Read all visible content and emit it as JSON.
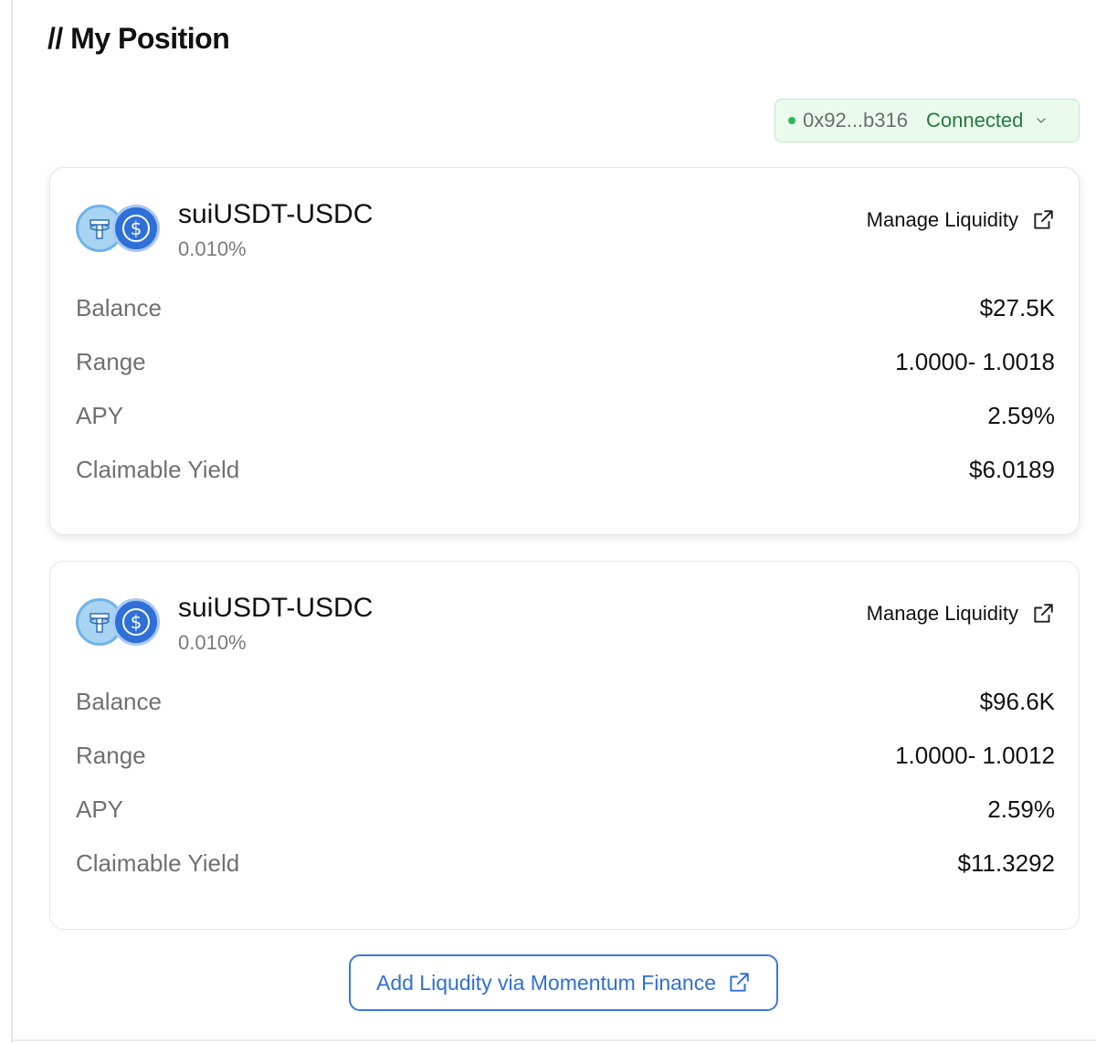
{
  "page": {
    "title": "// My Position"
  },
  "wallet": {
    "address": "0x92...b316",
    "status": "Connected"
  },
  "colors": {
    "accent": "#2f6fd8",
    "connected_green": "#2fb757",
    "connected_bg": "#eafbee"
  },
  "positions": [
    {
      "pair": "suiUSDT-USDC",
      "fee": "0.010%",
      "manage_label": "Manage Liquidity",
      "rows": [
        {
          "label": "Balance",
          "value": "$27.5K"
        },
        {
          "label": "Range",
          "value": "1.0000- 1.0018"
        },
        {
          "label": "APY",
          "value": "2.59%"
        },
        {
          "label": "Claimable Yield",
          "value": "$6.0189"
        }
      ]
    },
    {
      "pair": "suiUSDT-USDC",
      "fee": "0.010%",
      "manage_label": "Manage Liquidity",
      "rows": [
        {
          "label": "Balance",
          "value": "$96.6K"
        },
        {
          "label": "Range",
          "value": "1.0000- 1.0012"
        },
        {
          "label": "APY",
          "value": "2.59%"
        },
        {
          "label": "Claimable Yield",
          "value": "$11.3292"
        }
      ]
    }
  ],
  "footer": {
    "add_button_label": "Add Liqudity via Momentum Finance"
  },
  "icons": [
    "usdt-icon",
    "usdc-icon",
    "external-link-icon",
    "chevron-down-icon",
    "status-dot-icon"
  ]
}
